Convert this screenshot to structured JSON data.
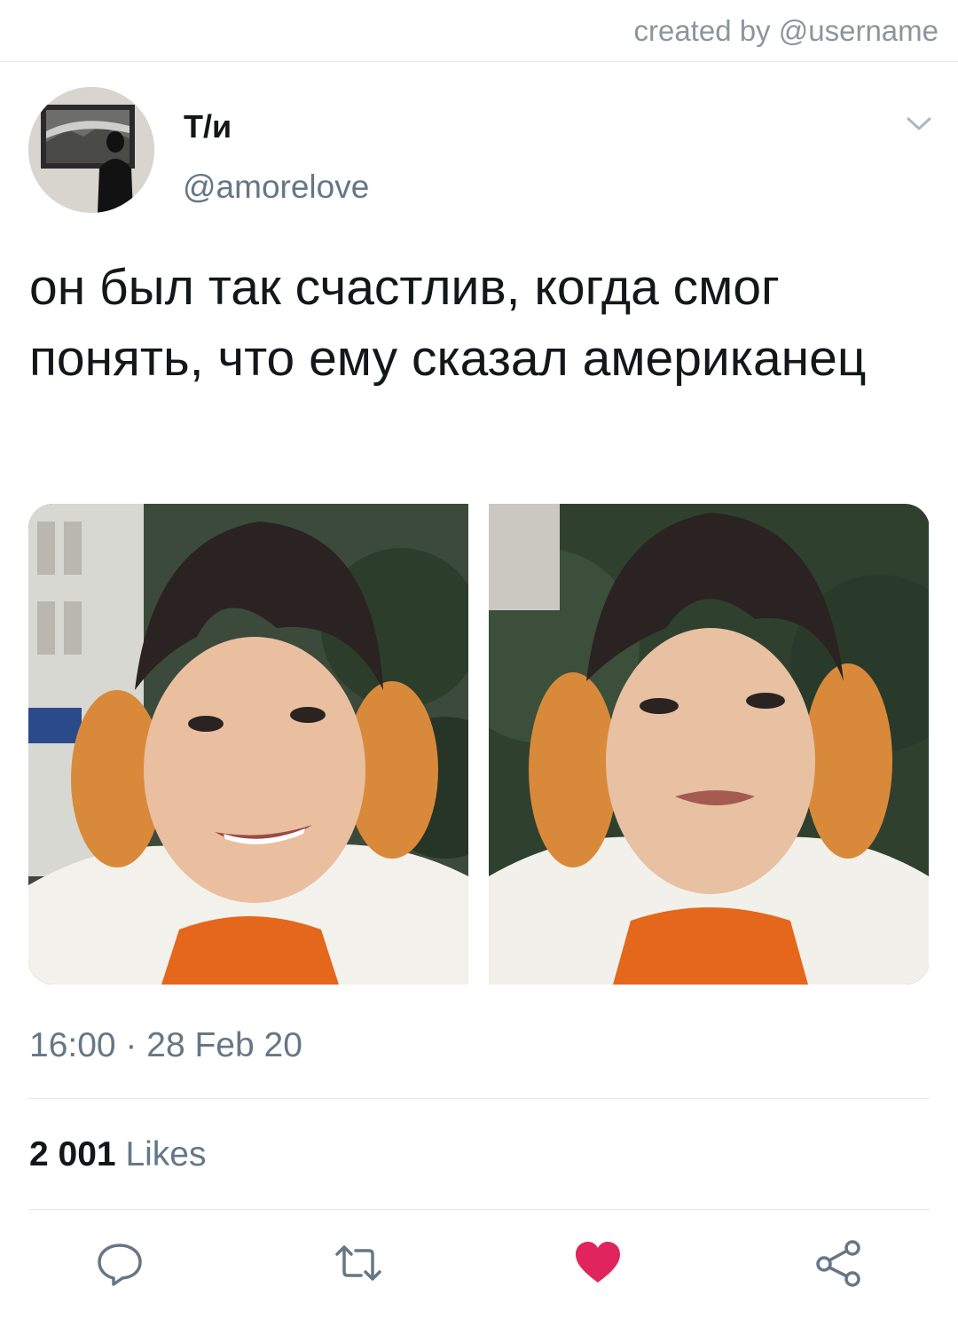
{
  "header": {
    "created_by": "created by @username"
  },
  "tweet": {
    "author_name": "Т/и",
    "author_handle": "@amorelove",
    "text": "он был так счастлив, когда смог понять, что ему сказал американец",
    "timestamp": "16:00 · 28 Feb 20",
    "likes_count": "2 001",
    "likes_label": "Likes"
  },
  "icons": {
    "menu": "chevron-down-icon",
    "reply": "reply-icon",
    "retweet": "retweet-icon",
    "like": "heart-icon",
    "share": "share-icon"
  },
  "colors": {
    "like_active": "#e0245e",
    "secondary_text": "#657786",
    "divider": "#e1e8ed"
  }
}
